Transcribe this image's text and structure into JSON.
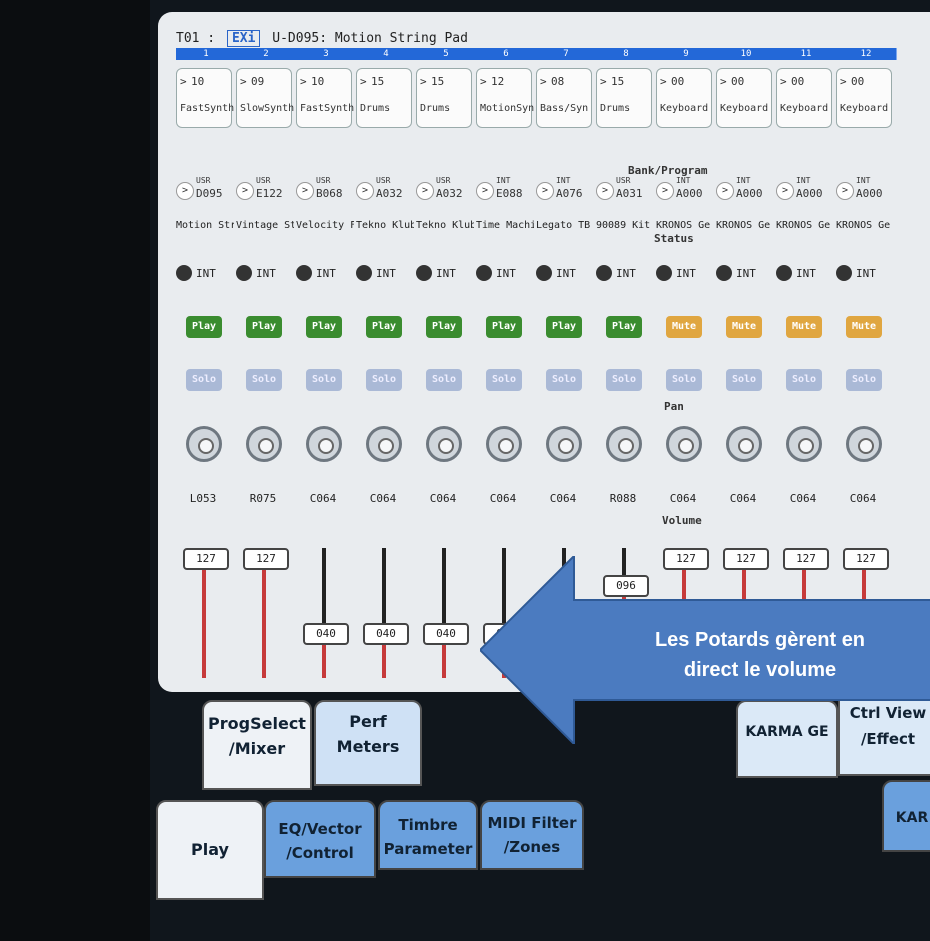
{
  "header": {
    "track": "T01",
    "mode": "EXi",
    "program": "U-D095: Motion String Pad"
  },
  "channels": [
    {
      "num": "1",
      "card_arrow": "10",
      "card_cat": "FastSynth",
      "bank_top": "USR",
      "bank_bot": "D095",
      "name": "Motion Stri",
      "status": "INT",
      "pm": "Play",
      "solo": "Solo",
      "pan": "L053",
      "volume": "127"
    },
    {
      "num": "2",
      "card_arrow": "09",
      "card_cat": "SlowSynth",
      "bank_top": "USR",
      "bank_bot": "E122",
      "name": "Vintage St",
      "status": "INT",
      "pm": "Play",
      "solo": "Solo",
      "pan": "R075",
      "volume": "127"
    },
    {
      "num": "3",
      "card_arrow": "10",
      "card_cat": "FastSynth",
      "bank_top": "USR",
      "bank_bot": "B068",
      "name": "Velocity Fil",
      "status": "INT",
      "pm": "Play",
      "solo": "Solo",
      "pan": "C064",
      "volume": "040"
    },
    {
      "num": "4",
      "card_arrow": "15",
      "card_cat": "Drums",
      "bank_top": "USR",
      "bank_bot": "A032",
      "name": "Tekno Klub",
      "status": "INT",
      "pm": "Play",
      "solo": "Solo",
      "pan": "C064",
      "volume": "040"
    },
    {
      "num": "5",
      "card_arrow": "15",
      "card_cat": "Drums",
      "bank_top": "USR",
      "bank_bot": "A032",
      "name": "Tekno Klub",
      "status": "INT",
      "pm": "Play",
      "solo": "Solo",
      "pan": "C064",
      "volume": "040"
    },
    {
      "num": "6",
      "card_arrow": "12",
      "card_cat": "MotionSyn",
      "bank_top": "INT",
      "bank_bot": "E088",
      "name": "Time Machi",
      "status": "INT",
      "pm": "Play",
      "solo": "Solo",
      "pan": "C064",
      "volume": "040"
    },
    {
      "num": "7",
      "card_arrow": "08",
      "card_cat": "Bass/Syn",
      "bank_top": "INT",
      "bank_bot": "A076",
      "name": "Legato TB",
      "status": "INT",
      "pm": "Play",
      "solo": "Solo",
      "pan": "C064",
      "volume": ""
    },
    {
      "num": "8",
      "card_arrow": "15",
      "card_cat": "Drums",
      "bank_top": "USR",
      "bank_bot": "A031",
      "name": "90089 Kit",
      "status": "INT",
      "pm": "Play",
      "solo": "Solo",
      "pan": "R088",
      "volume": "096"
    },
    {
      "num": "9",
      "card_arrow": "00",
      "card_cat": "Keyboard",
      "bank_top": "INT",
      "bank_bot": "A000",
      "name": "KRONOS Ge",
      "status": "INT",
      "pm": "Mute",
      "solo": "Solo",
      "pan": "C064",
      "volume": "127"
    },
    {
      "num": "10",
      "card_arrow": "00",
      "card_cat": "Keyboard",
      "bank_top": "INT",
      "bank_bot": "A000",
      "name": "KRONOS Ge",
      "status": "INT",
      "pm": "Mute",
      "solo": "Solo",
      "pan": "C064",
      "volume": "127"
    },
    {
      "num": "11",
      "card_arrow": "00",
      "card_cat": "Keyboard",
      "bank_top": "INT",
      "bank_bot": "A000",
      "name": "KRONOS Ge",
      "status": "INT",
      "pm": "Mute",
      "solo": "Solo",
      "pan": "C064",
      "volume": "127"
    },
    {
      "num": "12",
      "card_arrow": "00",
      "card_cat": "Keyboard",
      "bank_top": "INT",
      "bank_bot": "A000",
      "name": "KRONOS Ge",
      "status": "INT",
      "pm": "Mute",
      "solo": "Solo",
      "pan": "C064",
      "volume": "127"
    }
  ],
  "sections": {
    "bank": "Bank/Program",
    "status": "Status",
    "pan": "Pan",
    "volume": "Volume"
  },
  "tabs": {
    "progselect": "ProgSelect",
    "mixer": "/Mixer",
    "perf": "Perf",
    "meters": "Meters",
    "karmage": "KARMA GE",
    "ctrlview": "Ctrl View",
    "effect": "/Effect",
    "play": "Play",
    "eq": "EQ/Vector",
    "control": "/Control",
    "timbre": "Timbre",
    "parameter": "Parameter",
    "midi": "MIDI Filter",
    "zones": "/Zones",
    "kar": "KAR"
  },
  "callout": {
    "line1": "Les Potards gèrent en",
    "line2": "direct le volume"
  },
  "colors": {
    "play": "#3a8c2f",
    "mute": "#e0a640",
    "accent": "#2368d8",
    "callout": "#4b7bc0"
  }
}
